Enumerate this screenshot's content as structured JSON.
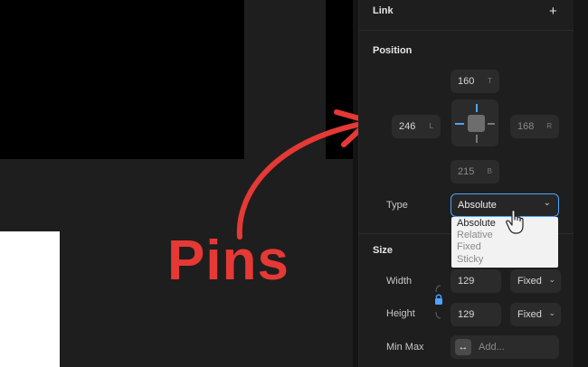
{
  "panel": {
    "link_title": "Link",
    "link_add": "+",
    "position_title": "Position",
    "pins": {
      "top": {
        "value": "160",
        "suffix": "T"
      },
      "left": {
        "value": "246",
        "suffix": "L"
      },
      "right": {
        "value": "168",
        "suffix": "R"
      },
      "bottom": {
        "value": "215",
        "suffix": "B"
      }
    },
    "type_label": "Type",
    "type_value": "Absolute",
    "type_chevron": "⌄",
    "type_options": [
      "Absolute",
      "Relative",
      "Fixed",
      "Sticky"
    ],
    "size_title": "Size",
    "width_label": "Width",
    "width_value": "129",
    "width_mode": "Fixed",
    "height_label": "Height",
    "height_value": "129",
    "height_mode": "Fixed",
    "minmax_label": "Min Max",
    "minmax_icon": "↔",
    "minmax_placeholder": "Add..."
  },
  "annotation": {
    "text": "Pins",
    "color": "#e53935"
  },
  "colors": {
    "accent": "#4ea3ff",
    "panel_bg": "#1e1e1e",
    "input_bg": "#2b2b2b"
  },
  "icons": [
    "chevron-down-icon",
    "lock-icon",
    "pointer-hand-icon",
    "resize-horizontal-icon",
    "plus-icon"
  ]
}
